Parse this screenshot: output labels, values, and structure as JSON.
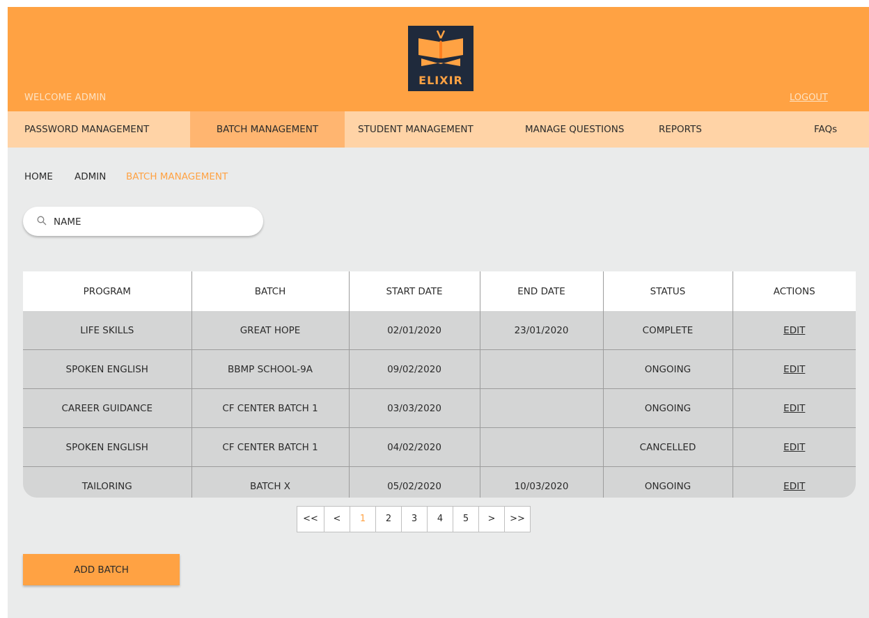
{
  "header": {
    "welcome": "WELCOME ADMIN",
    "logout": "LOGOUT",
    "logo_text": "ELIXIR"
  },
  "nav": {
    "password": "PASSWORD MANAGEMENT",
    "batch": "BATCH MANAGEMENT",
    "student": "STUDENT  MANAGEMENT",
    "questions": "MANAGE QUESTIONS",
    "reports": "REPORTS",
    "faqs": "FAQs"
  },
  "breadcrumb": {
    "home": "HOME",
    "admin": "ADMIN",
    "current": "BATCH MANAGEMENT"
  },
  "search": {
    "placeholder": "NAME"
  },
  "table": {
    "headers": [
      "PROGRAM",
      "BATCH",
      "START DATE",
      "END DATE",
      "STATUS",
      "ACTIONS"
    ],
    "rows": [
      [
        "LIFE SKILLS",
        "GREAT HOPE",
        "02/01/2020",
        "23/01/2020",
        "COMPLETE",
        "EDIT"
      ],
      [
        "SPOKEN ENGLISH",
        "BBMP SCHOOL-9A",
        "09/02/2020",
        "",
        "ONGOING",
        "EDIT"
      ],
      [
        "CAREER GUIDANCE",
        "CF CENTER BATCH 1",
        "03/03/2020",
        "",
        "ONGOING",
        "EDIT"
      ],
      [
        "SPOKEN ENGLISH",
        "CF CENTER BATCH 1",
        "04/02/2020",
        "",
        "CANCELLED",
        "EDIT"
      ],
      [
        "TAILORING",
        "BATCH X",
        "05/02/2020",
        "10/03/2020",
        "ONGOING",
        "EDIT"
      ]
    ]
  },
  "pagination": {
    "first": "<<",
    "prev": "<",
    "pages": [
      "1",
      "2",
      "3",
      "4",
      "5"
    ],
    "next": ">",
    "last": ">>",
    "current": "1"
  },
  "add_batch_label": "ADD BATCH",
  "colors": {
    "accent": "#ffa243",
    "nav_bg": "#ffd3a6",
    "nav_active": "#ffb570",
    "logo_bg": "#1f2a3c",
    "page_bg": "#eaebeb",
    "row_bg": "#d4d5d5"
  }
}
